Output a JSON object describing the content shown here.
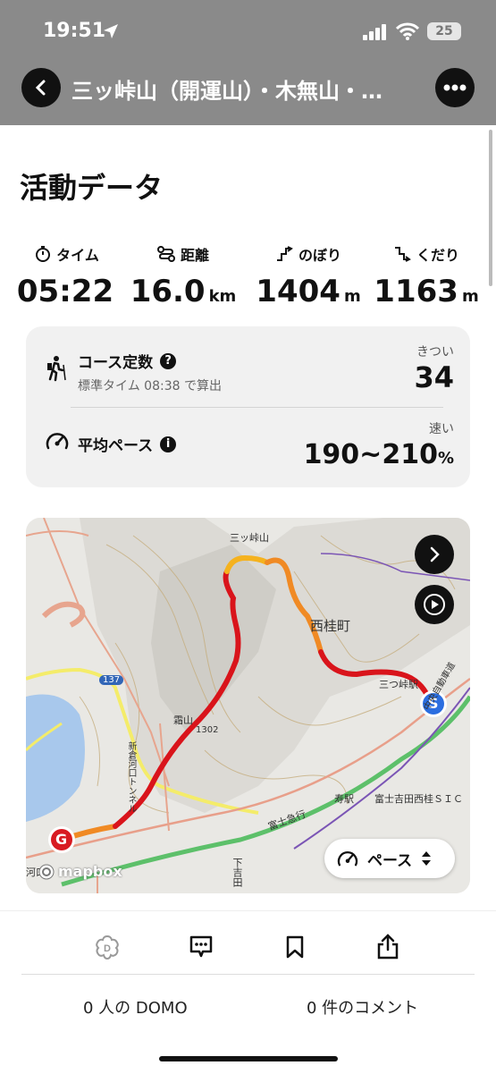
{
  "status": {
    "time": "19:51",
    "battery": "25"
  },
  "header": {
    "title": "三ッ峠山（開運山）・木無山・…"
  },
  "section": {
    "title": "活動データ"
  },
  "stats": [
    {
      "label": "タイム",
      "value": "05:22",
      "unit": ""
    },
    {
      "label": "距離",
      "value": "16.0",
      "unit": "km"
    },
    {
      "label": "のぼり",
      "value": "1404",
      "unit": "m"
    },
    {
      "label": "くだり",
      "value": "1163",
      "unit": "m"
    }
  ],
  "course": {
    "title": "コース定数",
    "sub": "標準タイム 08:38 で算出",
    "level": "きつい",
    "value": "34"
  },
  "pace": {
    "title": "平均ペース",
    "level": "速い",
    "value": "190~210",
    "unit": "%"
  },
  "map": {
    "labels": {
      "mitsutoge": "三ッ峠山",
      "nishikatsura": "西桂町",
      "station": "三つ峠駅",
      "shimoyoshida": "下吉田",
      "kiriyama": "霜山",
      "elev": "1302",
      "route137": "137",
      "expressway": "中央自動車道",
      "ic": "富士吉田西桂ＳＩＣ",
      "tunnel": "新倉河口トンネル",
      "fujikyu": "富士急行",
      "kotobuki": "寿駅",
      "kawaguchi": "河口"
    },
    "start_marker": "S",
    "goal_marker": "G",
    "pace_button": "ペース",
    "attribution": "mapbox",
    "colors": {
      "route_slow": "#d9141b",
      "route_mid": "#f08a24",
      "route_fast": "#f5b21e"
    }
  },
  "actions": [
    "domo-icon",
    "comment-icon",
    "bookmark-icon",
    "share-icon"
  ],
  "footer": {
    "domo": "0 人の DOMO",
    "comments": "0 件のコメント"
  }
}
